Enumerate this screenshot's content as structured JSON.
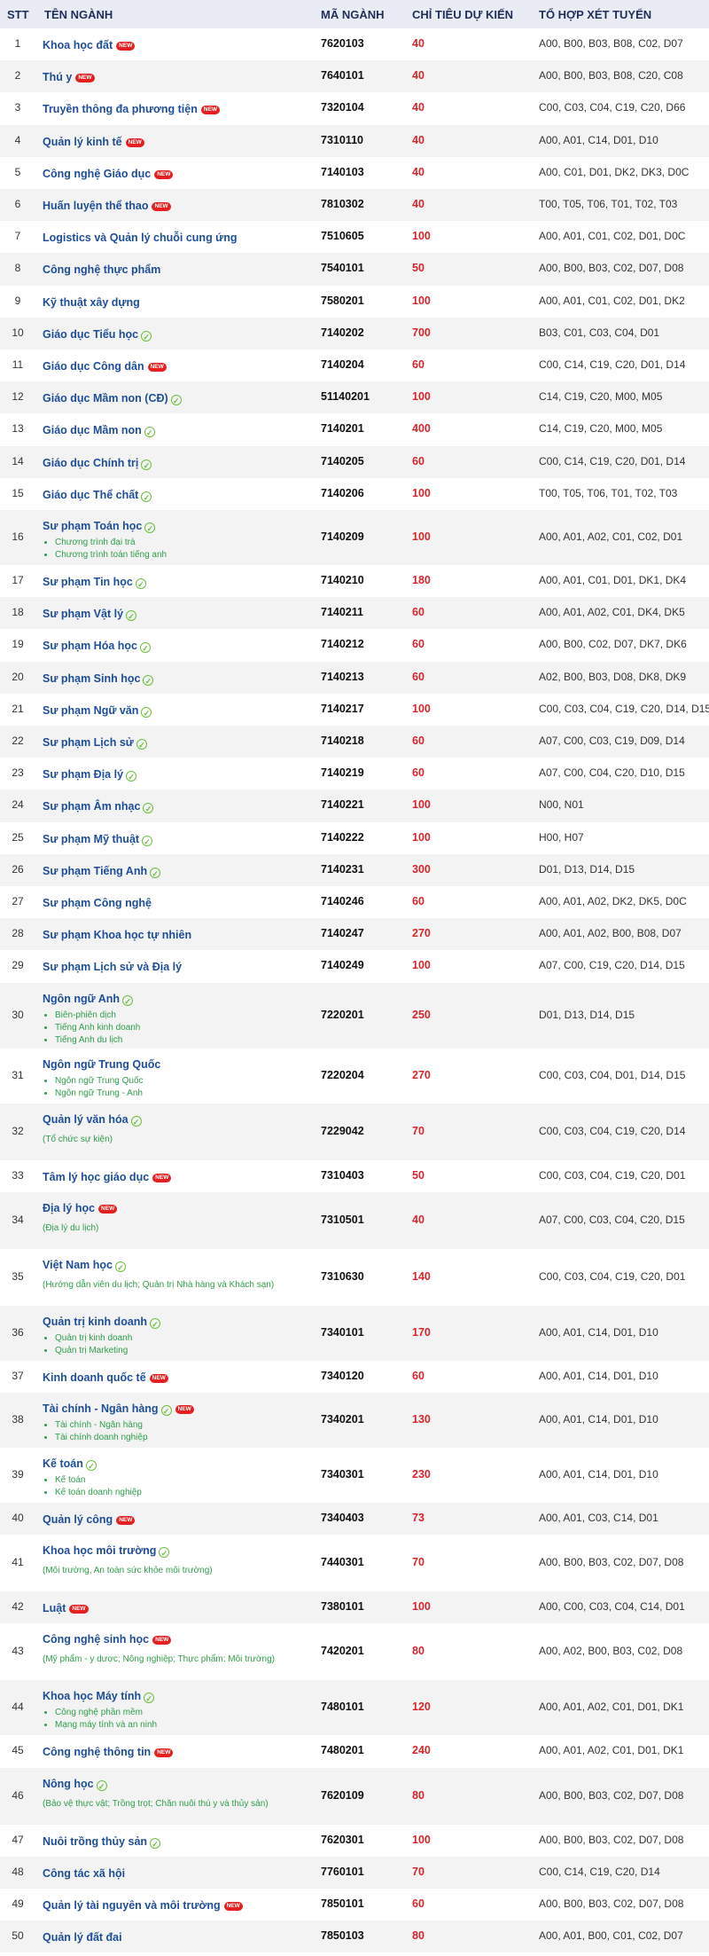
{
  "header": {
    "stt": "STT",
    "name": "TÊN NGÀNH",
    "code": "MÃ NGÀNH",
    "quota": "CHỈ TIÊU DỰ KIẾN",
    "combo": "TỔ HỢP XÉT TUYỂN"
  },
  "new_badge": "NEW",
  "check_icon": "✓",
  "rows": [
    {
      "stt": "1",
      "name": "Khoa học đất",
      "new": true,
      "code": "7620103",
      "quota": "40",
      "combo": "A00, B00, B03, B08, C02, D07"
    },
    {
      "stt": "2",
      "name": "Thú y",
      "new": true,
      "code": "7640101",
      "quota": "40",
      "combo": "A00, B00, B03, B08, C20, C08"
    },
    {
      "stt": "3",
      "name": "Truyền thông đa phương tiện",
      "new": true,
      "code": "7320104",
      "quota": "40",
      "combo": "C00, C03, C04, C19, C20, D66"
    },
    {
      "stt": "4",
      "name": "Quản lý kinh tế",
      "new": true,
      "code": "7310110",
      "quota": "40",
      "combo": "A00, A01, C14, D01, D10"
    },
    {
      "stt": "5",
      "name": "Công nghệ Giáo dục",
      "new": true,
      "code": "7140103",
      "quota": "40",
      "combo": "A00, C01, D01, DK2, DK3, D0C"
    },
    {
      "stt": "6",
      "name": "Huấn luyện thể thao",
      "new": true,
      "code": "7810302",
      "quota": "40",
      "combo": "T00, T05, T06, T01, T02, T03"
    },
    {
      "stt": "7",
      "name": "Logistics và Quản lý chuỗi cung ứng",
      "code": "7510605",
      "quota": "100",
      "combo": "A00, A01, C01, C02, D01, D0C"
    },
    {
      "stt": "8",
      "name": "Công nghệ thực phẩm",
      "code": "7540101",
      "quota": "50",
      "combo": "A00, B00, B03, C02, D07, D08"
    },
    {
      "stt": "9",
      "name": "Kỹ thuật xây dựng",
      "code": "7580201",
      "quota": "100",
      "combo": "A00, A01, C01, C02, D01, DK2"
    },
    {
      "stt": "10",
      "name": "Giáo dục Tiểu học",
      "check": true,
      "code": "7140202",
      "quota": "700",
      "combo": "B03, C01, C03, C04, D01"
    },
    {
      "stt": "11",
      "name": "Giáo dục Công dân",
      "new": true,
      "code": "7140204",
      "quota": "60",
      "combo": "C00, C14, C19, C20, D01, D14"
    },
    {
      "stt": "12",
      "name": "Giáo dục Mầm non (CĐ)",
      "check": true,
      "code": "51140201",
      "quota": "100",
      "combo": "C14, C19, C20, M00, M05"
    },
    {
      "stt": "13",
      "name": "Giáo dục Mầm non",
      "check": true,
      "code": "7140201",
      "quota": "400",
      "combo": "C14, C19, C20, M00, M05"
    },
    {
      "stt": "14",
      "name": "Giáo dục Chính trị",
      "check": true,
      "code": "7140205",
      "quota": "60",
      "combo": "C00, C14, C19, C20, D01, D14"
    },
    {
      "stt": "15",
      "name": "Giáo dục Thể chất",
      "check": true,
      "code": "7140206",
      "quota": "100",
      "combo": "T00, T05, T06, T01, T02, T03"
    },
    {
      "stt": "16",
      "name": "Sư phạm Toán học",
      "check": true,
      "subs": [
        "Chương trình đại trà",
        "Chương trình toán tiếng anh"
      ],
      "code": "7140209",
      "quota": "100",
      "combo": "A00, A01, A02, C01, C02, D01"
    },
    {
      "stt": "17",
      "name": "Sư phạm Tin học",
      "check": true,
      "code": "7140210",
      "quota": "180",
      "combo": "A00, A01, C01, D01, DK1, DK4"
    },
    {
      "stt": "18",
      "name": "Sư phạm Vật lý",
      "check": true,
      "code": "7140211",
      "quota": "60",
      "combo": "A00, A01, A02, C01, DK4, DK5"
    },
    {
      "stt": "19",
      "name": "Sư phạm Hóa học",
      "check": true,
      "code": "7140212",
      "quota": "60",
      "combo": "A00, B00, C02, D07, DK7, DK6"
    },
    {
      "stt": "20",
      "name": "Sư phạm Sinh học",
      "check": true,
      "code": "7140213",
      "quota": "60",
      "combo": "A02, B00, B03, D08, DK8, DK9"
    },
    {
      "stt": "21",
      "name": "Sư phạm Ngữ văn",
      "check": true,
      "code": "7140217",
      "quota": "100",
      "combo": "C00, C03, C04, C19, C20, D14, D15"
    },
    {
      "stt": "22",
      "name": "Sư phạm Lịch sử",
      "check": true,
      "code": "7140218",
      "quota": "60",
      "combo": "A07, C00, C03, C19, D09, D14"
    },
    {
      "stt": "23",
      "name": "Sư phạm Địa lý",
      "check": true,
      "code": "7140219",
      "quota": "60",
      "combo": "A07, C00, C04, C20, D10, D15"
    },
    {
      "stt": "24",
      "name": "Sư phạm Âm nhạc",
      "check": true,
      "code": "7140221",
      "quota": "100",
      "combo": "N00, N01"
    },
    {
      "stt": "25",
      "name": "Sư phạm Mỹ thuật",
      "check": true,
      "code": "7140222",
      "quota": "100",
      "combo": "H00, H07"
    },
    {
      "stt": "26",
      "name": "Sư phạm Tiếng Anh",
      "check": true,
      "code": "7140231",
      "quota": "300",
      "combo": "D01, D13, D14, D15"
    },
    {
      "stt": "27",
      "name": "Sư phạm Công nghệ",
      "code": "7140246",
      "quota": "60",
      "combo": "A00, A01, A02, DK2, DK5, D0C"
    },
    {
      "stt": "28",
      "name": "Sư phạm Khoa học tự nhiên",
      "code": "7140247",
      "quota": "270",
      "combo": "A00, A01, A02, B00, B08, D07"
    },
    {
      "stt": "29",
      "name": "Sư phạm Lịch sử và Địa lý",
      "code": "7140249",
      "quota": "100",
      "combo": "A07, C00, C19, C20, D14, D15"
    },
    {
      "stt": "30",
      "name": "Ngôn ngữ Anh",
      "check": true,
      "subs": [
        "Biên-phiên dịch",
        "Tiếng Anh kinh doanh",
        "Tiếng Anh du lịch"
      ],
      "code": "7220201",
      "quota": "250",
      "combo": "D01, D13, D14, D15"
    },
    {
      "stt": "31",
      "name": "Ngôn ngữ Trung Quốc",
      "subs": [
        "Ngôn ngữ Trung Quốc",
        "Ngôn ngữ Trung - Anh"
      ],
      "code": "7220204",
      "quota": "270",
      "combo": "C00, C03, C04, D01, D14, D15"
    },
    {
      "stt": "32",
      "name": "Quản lý văn hóa",
      "check": true,
      "paren": "(Tổ chức sự kiện)",
      "code": "7229042",
      "quota": "70",
      "combo": "C00, C03, C04, C19, C20, D14"
    },
    {
      "stt": "33",
      "name": "Tâm lý học giáo dục",
      "new": true,
      "code": "7310403",
      "quota": "50",
      "combo": "C00, C03, C04, C19, C20, D01"
    },
    {
      "stt": "34",
      "name": "Địa lý học",
      "new": true,
      "paren": "(Địa lý du lịch)",
      "code": "7310501",
      "quota": "40",
      "combo": "A07, C00, C03, C04, C20, D15"
    },
    {
      "stt": "35",
      "name": "Việt Nam học",
      "check": true,
      "paren": "(Hướng dẫn viên du lịch; Quản trị Nhà hàng và Khách sạn)",
      "code": "7310630",
      "quota": "140",
      "combo": "C00, C03, C04, C19, C20, D01"
    },
    {
      "stt": "36",
      "name": "Quản trị kinh doanh",
      "check": true,
      "subs": [
        "Quản trị kinh doanh",
        "Quản trị Marketing"
      ],
      "code": "7340101",
      "quota": "170",
      "combo": "A00, A01, C14, D01, D10"
    },
    {
      "stt": "37",
      "name": "Kinh doanh quốc tế",
      "new": true,
      "code": "7340120",
      "quota": "60",
      "combo": "A00, A01, C14, D01, D10"
    },
    {
      "stt": "38",
      "name": "Tài chính - Ngân hàng",
      "check": true,
      "new": true,
      "subs": [
        "Tài chính - Ngân hàng",
        "Tài chính doanh nghiệp"
      ],
      "code": "7340201",
      "quota": "130",
      "combo": "A00, A01, C14, D01, D10"
    },
    {
      "stt": "39",
      "name": "Kế toán",
      "check": true,
      "subs": [
        "Kế toán",
        "Kế toán doanh nghiệp"
      ],
      "code": "7340301",
      "quota": "230",
      "combo": "A00, A01, C14, D01, D10"
    },
    {
      "stt": "40",
      "name": "Quản lý công",
      "new": true,
      "code": "7340403",
      "quota": "73",
      "combo": "A00, A01, C03, C14, D01"
    },
    {
      "stt": "41",
      "name": "Khoa học môi trường",
      "check": true,
      "paren": "(Môi trường, An toàn sức khỏe môi trường)",
      "code": "7440301",
      "quota": "70",
      "combo": "A00, B00, B03, C02, D07, D08"
    },
    {
      "stt": "42",
      "name": "Luật",
      "new": true,
      "code": "7380101",
      "quota": "100",
      "combo": "A00, C00, C03, C04, C14, D01"
    },
    {
      "stt": "43",
      "name": "Công nghệ sinh học",
      "new": true,
      "paren": "(Mỹ phẩm - y dược; Nông nghiệp; Thực phẩm; Môi trường)",
      "code": "7420201",
      "quota": "80",
      "combo": "A00, A02, B00, B03, C02, D08"
    },
    {
      "stt": "44",
      "name": "Khoa học Máy tính",
      "check": true,
      "subs": [
        "Công nghệ phần mềm",
        "Mạng máy tính và an ninh"
      ],
      "code": "7480101",
      "quota": "120",
      "combo": "A00, A01, A02, C01, D01, DK1"
    },
    {
      "stt": "45",
      "name": "Công nghệ thông tin",
      "new": true,
      "code": "7480201",
      "quota": "240",
      "combo": "A00, A01, A02, C01, D01, DK1"
    },
    {
      "stt": "46",
      "name": "Nông học",
      "check": true,
      "paren": "(Bảo vệ thực vật; Trồng trọt; Chăn nuôi thú y và thủy sản)",
      "code": "7620109",
      "quota": "80",
      "combo": "A00, B00, B03, C02, D07, D08"
    },
    {
      "stt": "47",
      "name": "Nuôi trồng thủy sản",
      "check": true,
      "code": "7620301",
      "quota": "100",
      "combo": "A00, B00, B03, C02, D07, D08"
    },
    {
      "stt": "48",
      "name": "Công tác xã hội",
      "code": "7760101",
      "quota": "70",
      "combo": "C00, C14, C19, C20, D14"
    },
    {
      "stt": "49",
      "name": "Quản lý tài nguyên và môi trường",
      "new": true,
      "code": "7850101",
      "quota": "60",
      "combo": "A00, B00, B03, C02, D07, D08"
    },
    {
      "stt": "50",
      "name": "Quản lý đất đai",
      "code": "7850103",
      "quota": "80",
      "combo": "A00, A01, B00, C01, C02, D07"
    }
  ]
}
